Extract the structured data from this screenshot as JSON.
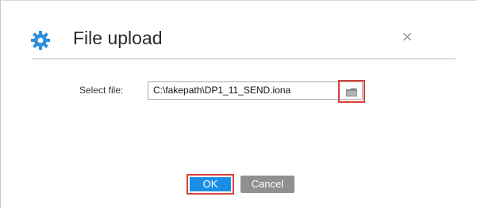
{
  "dialog": {
    "title": "File upload",
    "close_symbol": "×",
    "icon": "gear-icon"
  },
  "form": {
    "select_label": "Select file:",
    "file_value": "C:\\fakepath\\DP1_11_SEND.iona",
    "browse_icon": "folder-icon"
  },
  "buttons": {
    "ok_label": "OK",
    "cancel_label": "Cancel"
  },
  "colors": {
    "accent_blue": "#1a8ee6",
    "gear_blue": "#2f8fd8",
    "highlight_red": "#d9413a",
    "cancel_gray": "#8f8f8f"
  }
}
